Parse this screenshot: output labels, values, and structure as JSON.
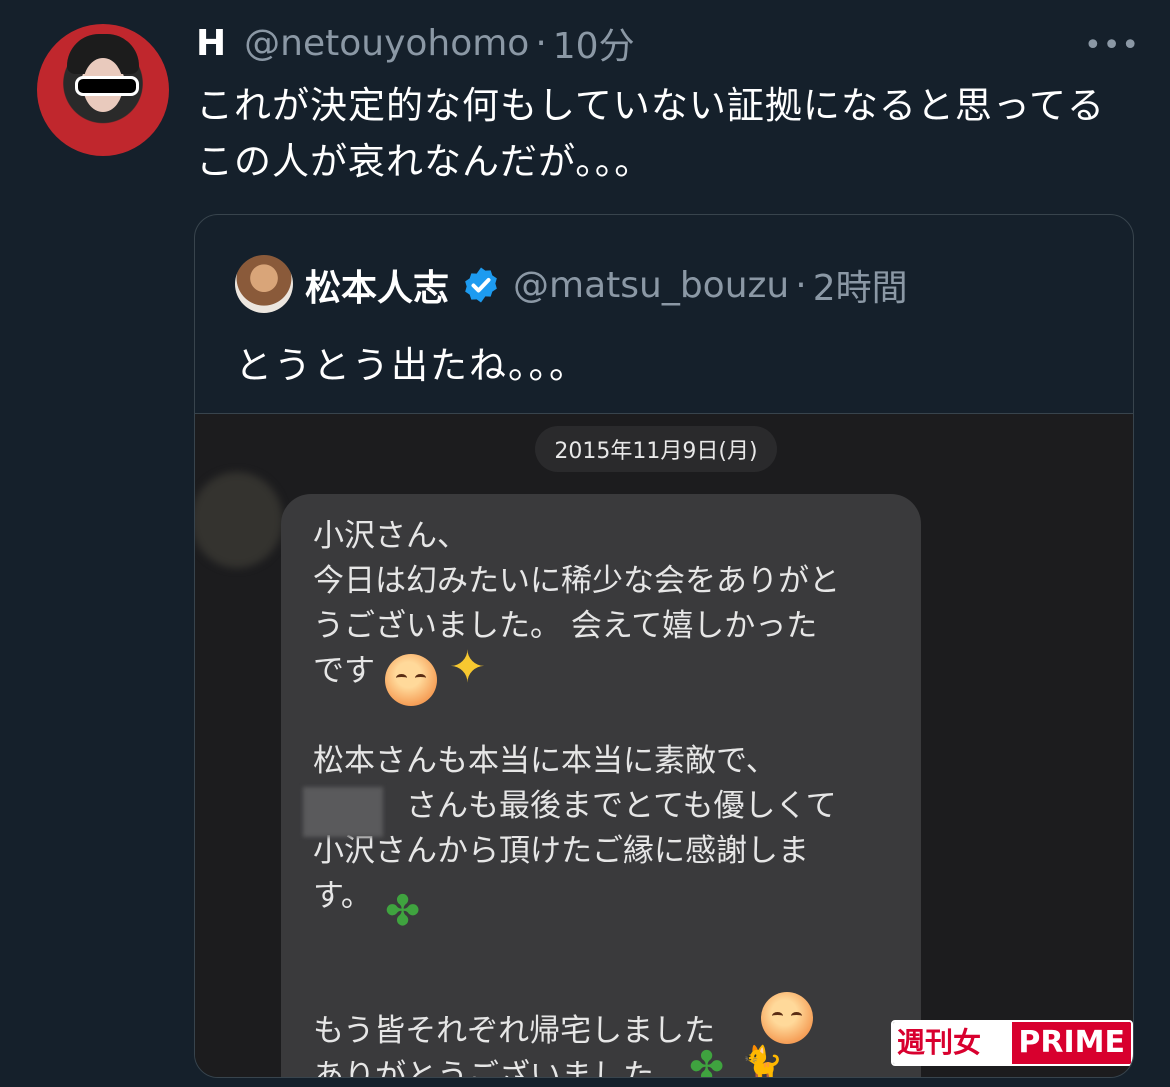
{
  "tweet": {
    "display_name": "H",
    "handle": "@netouyohomo",
    "separator": "·",
    "time": "10分",
    "more_label": "•••",
    "text": "これが決定的な何もしていない証拠になると思ってるこの人が哀れなんだが。。。"
  },
  "quote": {
    "display_name": "松本人志",
    "handle": "@matsu_bouzu",
    "separator": "·",
    "time": "2時間",
    "text": "とうとう出たね。。。",
    "verified": true
  },
  "screenshot": {
    "date": "2015年11月9日(月)",
    "message": "小沢さん、\n今日は幻みたいに稀少な会をありがと\nうございました。 会えて嬉しかった\nです\n\n松本さんも本当に本当に素敵で、\n　　　さんも最後までとても優しくて\n小沢さんから頂けたご縁に感謝しま\nす。\n\n\nもう皆それぞれ帰宅しました\nありがとうございました",
    "watermark_left": "週刊女性",
    "watermark_right": "PRIME",
    "icons": [
      "blush-emoji-icon",
      "sparkles-icon",
      "four-leaf-clover-icon",
      "cat-icon"
    ]
  },
  "colors": {
    "background": "#15202b",
    "secondary_text": "#8b98a5",
    "verified_blue": "#1d9bf0",
    "watermark_red": "#d8002e"
  }
}
